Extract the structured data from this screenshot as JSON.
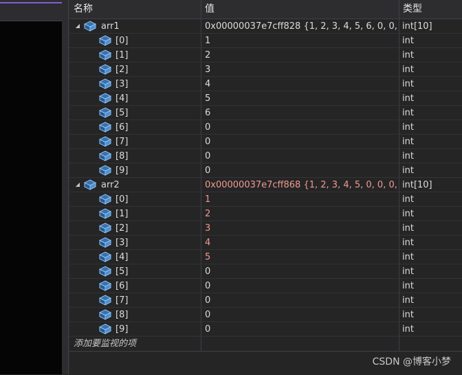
{
  "columns": {
    "name": "名称",
    "value": "值",
    "type": "类型"
  },
  "watch_items": [
    {
      "name": "arr1",
      "value": "0x00000037e7cff828 {1, 2, 3, 4, 5, 6, 0, 0, 0...",
      "type": "int[10]",
      "changed": false,
      "children": [
        {
          "name": "[0]",
          "value": "1",
          "type": "int",
          "changed": false
        },
        {
          "name": "[1]",
          "value": "2",
          "type": "int",
          "changed": false
        },
        {
          "name": "[2]",
          "value": "3",
          "type": "int",
          "changed": false
        },
        {
          "name": "[3]",
          "value": "4",
          "type": "int",
          "changed": false
        },
        {
          "name": "[4]",
          "value": "5",
          "type": "int",
          "changed": false
        },
        {
          "name": "[5]",
          "value": "6",
          "type": "int",
          "changed": false
        },
        {
          "name": "[6]",
          "value": "0",
          "type": "int",
          "changed": false
        },
        {
          "name": "[7]",
          "value": "0",
          "type": "int",
          "changed": false
        },
        {
          "name": "[8]",
          "value": "0",
          "type": "int",
          "changed": false
        },
        {
          "name": "[9]",
          "value": "0",
          "type": "int",
          "changed": false
        }
      ]
    },
    {
      "name": "arr2",
      "value": "0x00000037e7cff868 {1, 2, 3, 4, 5, 0, 0, 0, 0...",
      "type": "int[10]",
      "changed": true,
      "children": [
        {
          "name": "[0]",
          "value": "1",
          "type": "int",
          "changed": true
        },
        {
          "name": "[1]",
          "value": "2",
          "type": "int",
          "changed": true
        },
        {
          "name": "[2]",
          "value": "3",
          "type": "int",
          "changed": true
        },
        {
          "name": "[3]",
          "value": "4",
          "type": "int",
          "changed": true
        },
        {
          "name": "[4]",
          "value": "5",
          "type": "int",
          "changed": true
        },
        {
          "name": "[5]",
          "value": "0",
          "type": "int",
          "changed": false
        },
        {
          "name": "[6]",
          "value": "0",
          "type": "int",
          "changed": false
        },
        {
          "name": "[7]",
          "value": "0",
          "type": "int",
          "changed": false
        },
        {
          "name": "[8]",
          "value": "0",
          "type": "int",
          "changed": false
        },
        {
          "name": "[9]",
          "value": "0",
          "type": "int",
          "changed": false
        }
      ]
    }
  ],
  "add_watch_placeholder": "添加要监视的项",
  "watermark": "CSDN @博客小梦",
  "icons": {
    "expanded": "triangle-down-right-icon",
    "variable": "object-cube-icon"
  },
  "colors": {
    "changed_value": "#f19b8f",
    "icon_blue": "#5aa0e6"
  }
}
